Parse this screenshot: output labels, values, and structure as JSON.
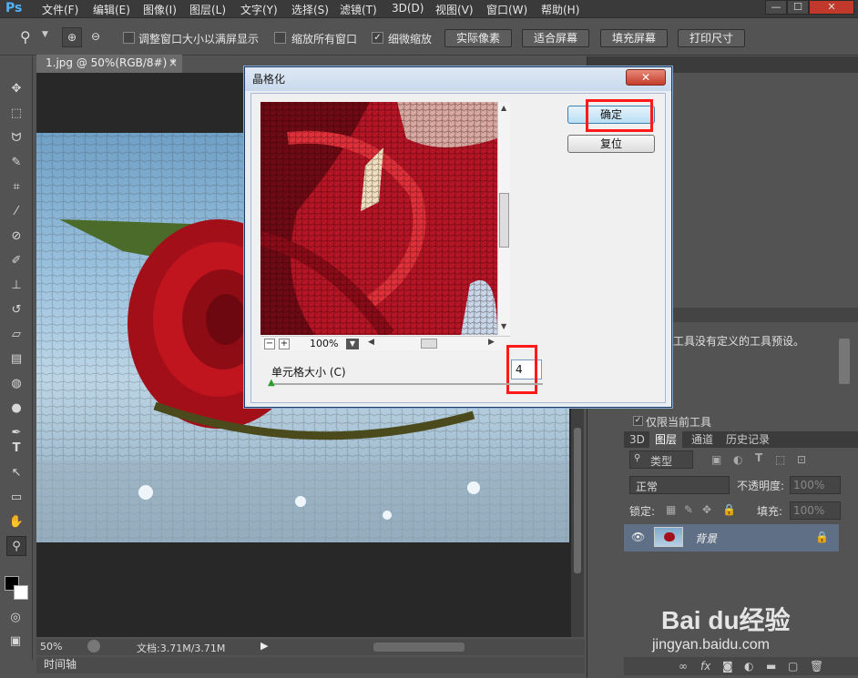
{
  "app": {
    "logo": "Ps"
  },
  "menu": [
    "文件(F)",
    "编辑(E)",
    "图像(I)",
    "图层(L)",
    "文字(Y)",
    "选择(S)",
    "滤镜(T)",
    "3D(D)",
    "视图(V)",
    "窗口(W)",
    "帮助(H)"
  ],
  "window_controls": {
    "minimize": "—",
    "maximize": "☐",
    "close": "✕"
  },
  "options": {
    "resize_window": "调整窗口大小以满屏显示",
    "zoom_all": "缩放所有窗口",
    "scrubby_zoom": "细微缩放",
    "actual_pixels": "实际像素",
    "fit_screen": "适合屏幕",
    "fill_screen": "填充屏幕",
    "print_size": "打印尺寸"
  },
  "document": {
    "tab_title": "1.jpg @ 50%(RGB/8#) *",
    "zoom": "50%",
    "doc_info": "文档:3.71M/3.71M"
  },
  "timeline": {
    "label": "时间轴"
  },
  "dialog": {
    "title": "晶格化",
    "ok_label": "确定",
    "reset_label": "复位",
    "preview_zoom": "100%",
    "cell_size_label": "单元格大小 (C)",
    "cell_size_value": "4",
    "cell_size_level": 0
  },
  "right_panel": {
    "tool_preset_msg": "工具没有定义的工具预设。",
    "current_tool_only": "仅限当前工具",
    "tabs": [
      "3D",
      "图层",
      "通道",
      "历史记录"
    ],
    "kind_label": "类型",
    "blend_mode": "正常",
    "opacity_label": "不透明度:",
    "opacity_value": "100%",
    "lock_label": "锁定:",
    "fill_label": "填充:",
    "fill_value": "100%",
    "layer_name": "背景"
  },
  "watermark": {
    "brand": "Bai du经验",
    "url": "jingyan.baidu.com"
  },
  "colors": {
    "highlight": "#ff1a1a",
    "ps_blue": "#4fb3ff",
    "dialog_bg": "#f0f0f0"
  }
}
